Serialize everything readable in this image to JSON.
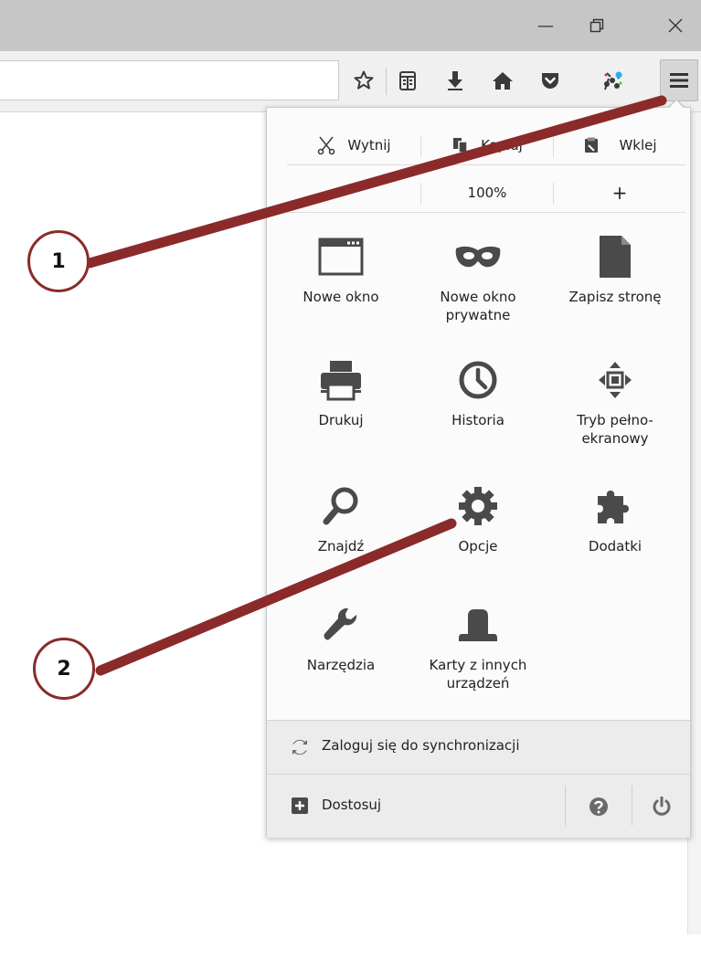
{
  "window": {
    "minimize_glyph": "—",
    "restore_glyph": "⧉",
    "close_glyph": "✕"
  },
  "toolbar": {
    "icons": [
      "bookmark-star-icon",
      "reading-list-icon",
      "download-icon",
      "home-icon",
      "pocket-icon",
      "extension-icon",
      "hamburger-menu-icon"
    ],
    "menu_glyph": "≡"
  },
  "menu": {
    "edit": {
      "cut": "Wytnij",
      "copy": "Kopiuj",
      "paste": "Wklej"
    },
    "zoom": {
      "minus": "−",
      "level": "100%",
      "plus": "+"
    },
    "items": [
      {
        "label": "Nowe okno"
      },
      {
        "label": "Nowe okno prywatne"
      },
      {
        "label": "Zapisz stronę"
      },
      {
        "label": "Drukuj"
      },
      {
        "label": "Historia"
      },
      {
        "label": "Tryb pełno-ekranowy"
      },
      {
        "label": "Znajdź"
      },
      {
        "label": "Opcje"
      },
      {
        "label": "Dodatki"
      },
      {
        "label": "Narzędzia"
      },
      {
        "label": "Karty z innych urządzeń"
      }
    ],
    "sync_label": "Zaloguj się do synchronizacji",
    "customize_label": "Dostosuj"
  },
  "annotations": [
    {
      "number": "1",
      "target": "hamburger-menu-icon"
    },
    {
      "number": "2",
      "target": "options-icon"
    }
  ],
  "colors": {
    "annotation": "#8b2a2a",
    "icon": "#4a4a4a",
    "titlebar": "#c6c6c6"
  }
}
